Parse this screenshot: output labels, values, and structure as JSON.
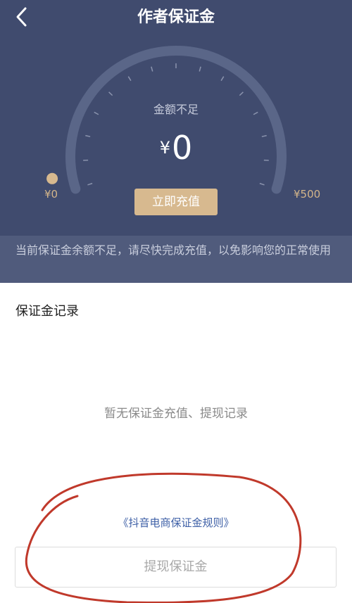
{
  "header": {
    "title": "作者保证金",
    "back_icon": "chevron-left-icon"
  },
  "gauge": {
    "label": "金额不足",
    "currency": "¥",
    "amount": "0",
    "current_value": 0,
    "max_value": 500,
    "min_label": "¥0",
    "max_label": "¥500"
  },
  "recharge_button": "立即充值",
  "notice": "当前保证金余额不足，请尽快完成充值，以免影响您的正常使用",
  "records": {
    "title": "保证金记录",
    "empty_text": "暂无保证金充值、提现记录"
  },
  "rules_link": "《抖音电商保证金规则》",
  "withdraw_button": "提现保证金",
  "colors": {
    "hero_bg": "#404b6e",
    "notice_bg": "#505b7c",
    "accent_gold": "#d7b98f",
    "link_blue": "#3d5fa6",
    "annotation_red": "#c0392b"
  }
}
